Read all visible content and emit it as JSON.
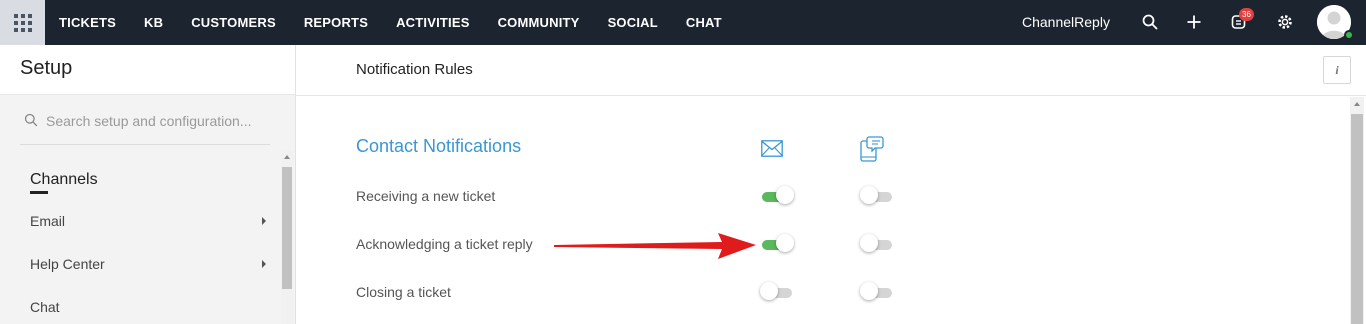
{
  "topbar": {
    "apps_icon": "apps-grid-icon",
    "nav": [
      "TICKETS",
      "KB",
      "CUSTOMERS",
      "REPORTS",
      "ACTIVITIES",
      "COMMUNITY",
      "SOCIAL",
      "CHAT"
    ],
    "brand": "ChannelReply",
    "badge_count": "36",
    "icons": [
      "search-icon",
      "plus-icon",
      "notification-icon",
      "gear-icon",
      "avatar"
    ]
  },
  "sidebar": {
    "title": "Setup",
    "search_placeholder": "Search setup and configuration...",
    "section": "Channels",
    "items": [
      {
        "label": "Email",
        "has_arrow": true
      },
      {
        "label": "Help Center",
        "has_arrow": true
      },
      {
        "label": "Chat",
        "has_arrow": false
      }
    ]
  },
  "main": {
    "page_title": "Notification Rules",
    "info_label": "i",
    "section_title": "Contact Notifications",
    "columns": [
      "email-icon",
      "mobile-chat-icon"
    ],
    "rules": [
      {
        "label": "Receiving a new ticket",
        "email_on": true,
        "mobile_on": false
      },
      {
        "label": "Acknowledging a ticket reply",
        "email_on": true,
        "mobile_on": false
      },
      {
        "label": "Closing a ticket",
        "email_on": false,
        "mobile_on": false
      }
    ]
  },
  "colors": {
    "topbar_bg": "#1c2430",
    "accent_blue": "#3a97d4",
    "toggle_on": "#5cb85c",
    "badge": "#e0403f",
    "annotation_arrow": "#e01b1b"
  }
}
